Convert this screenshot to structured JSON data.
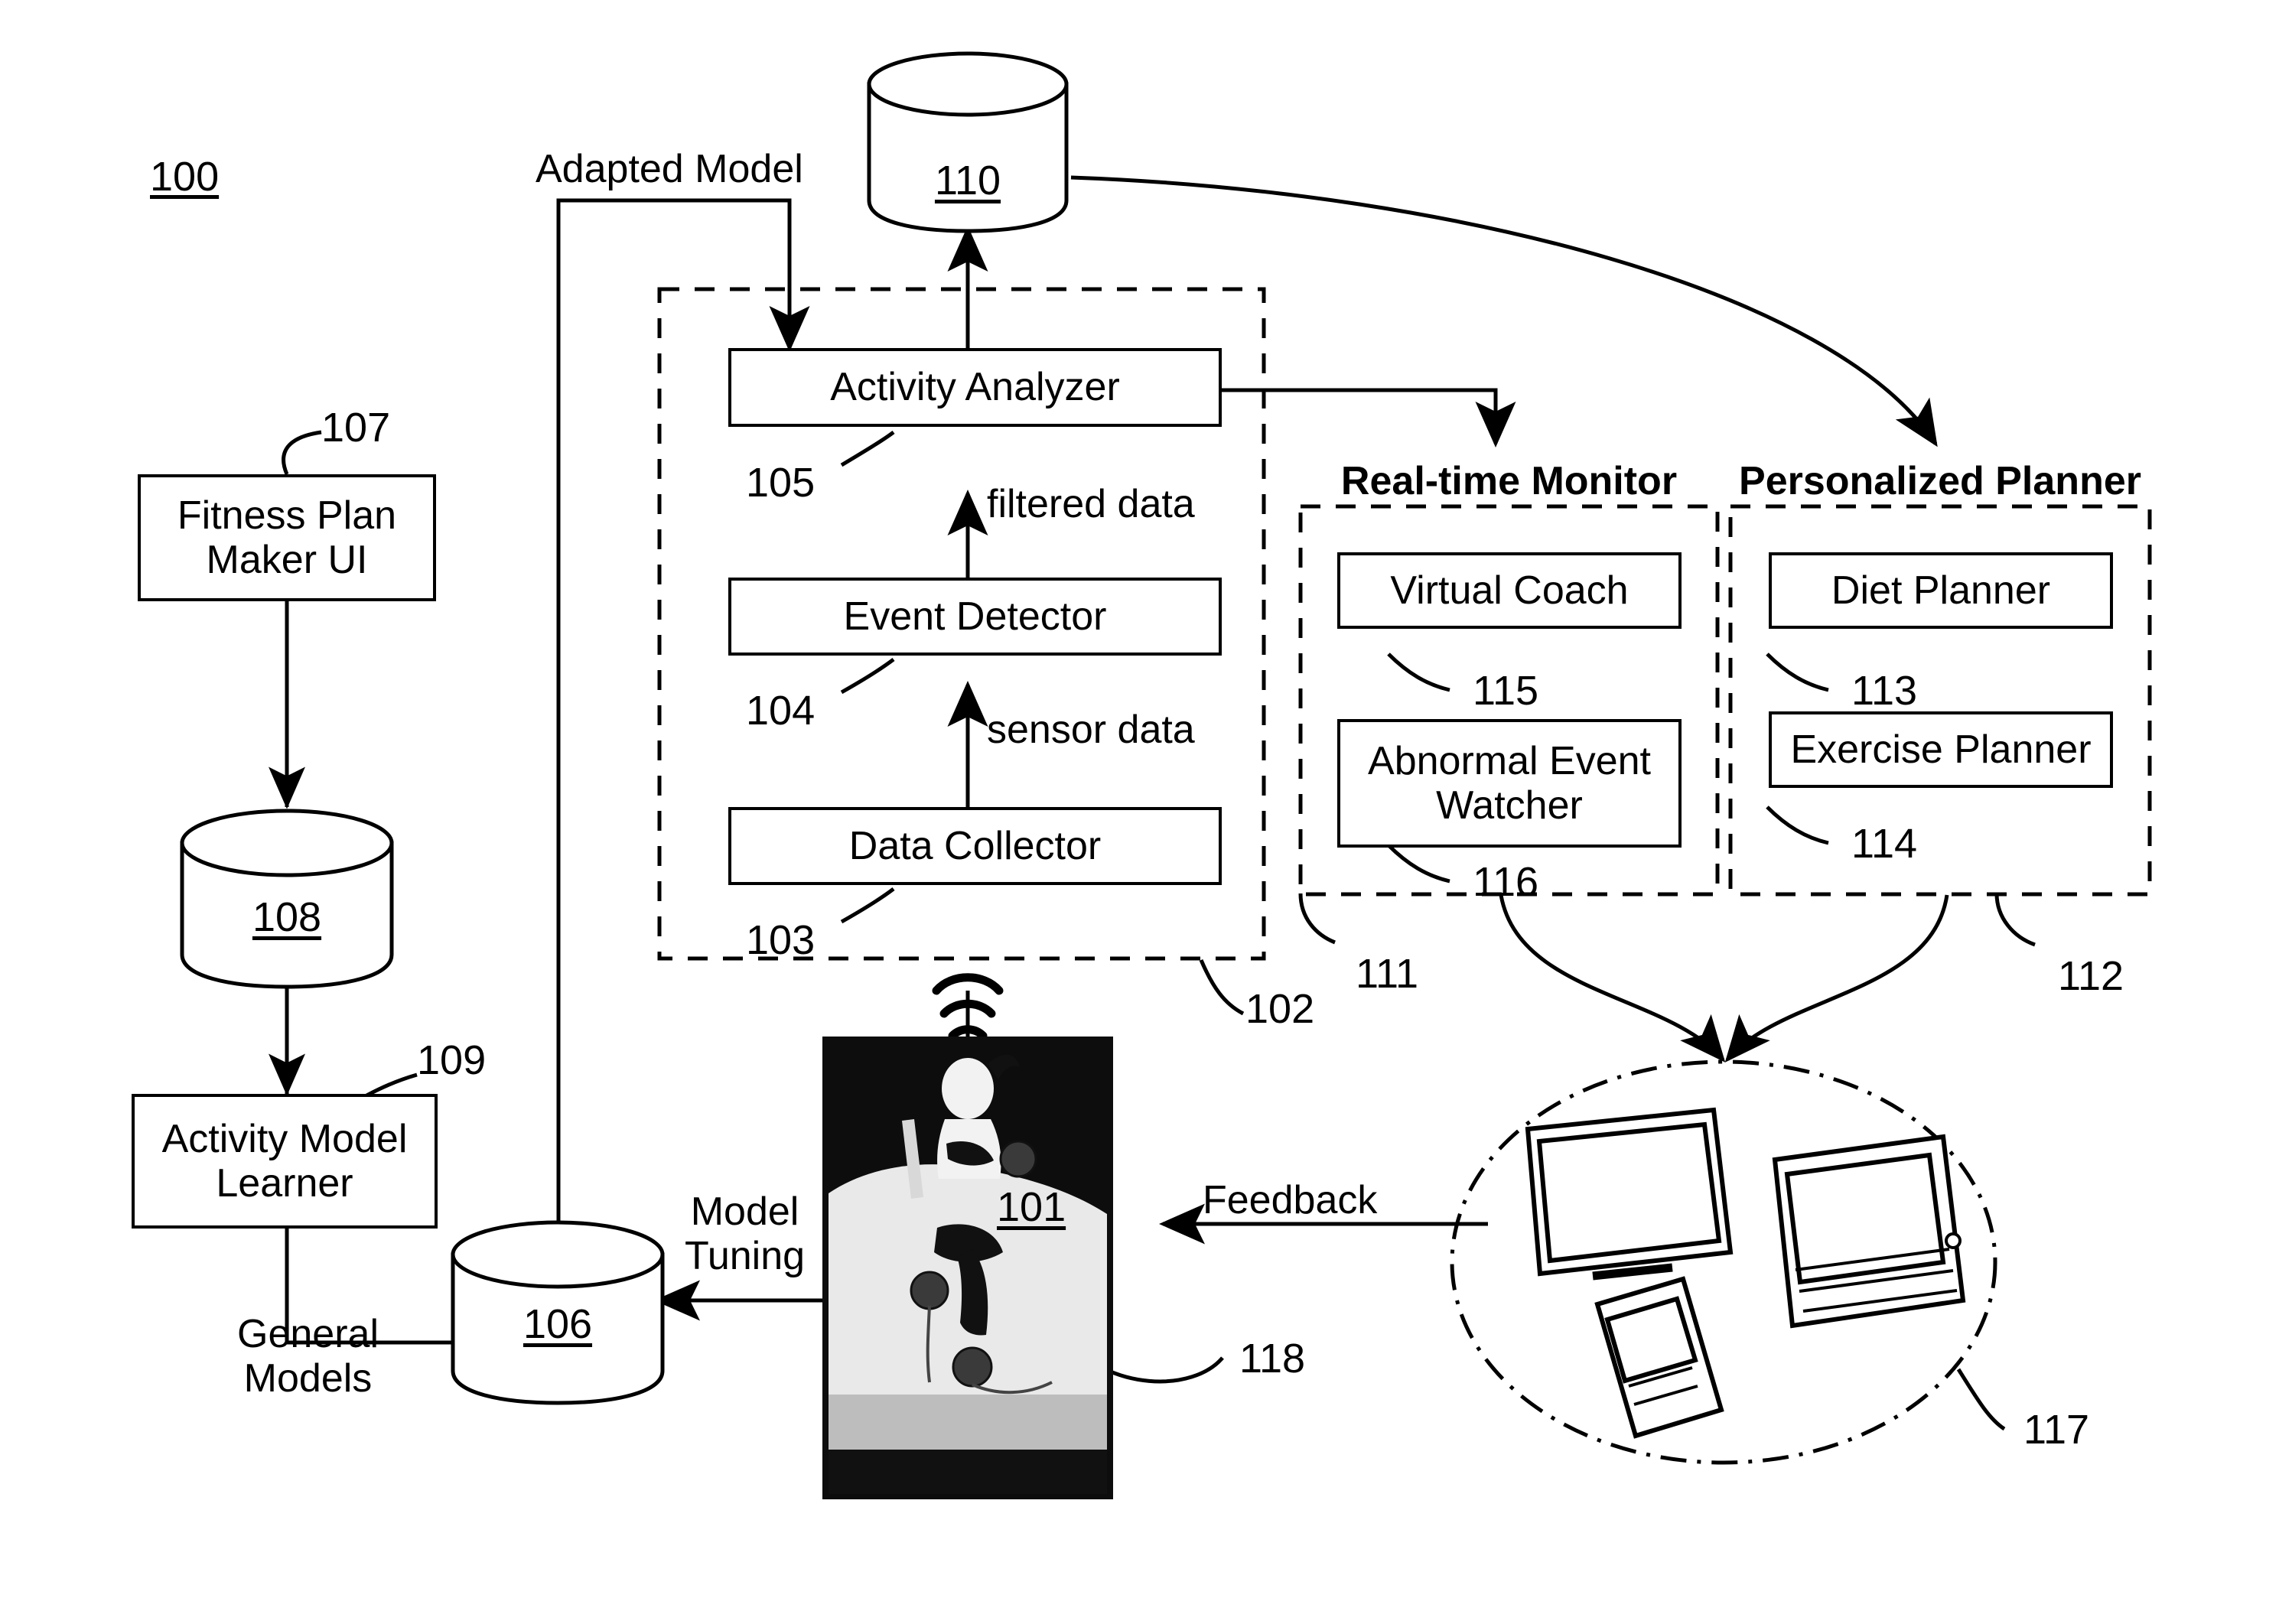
{
  "figure": {
    "ref_number": "100"
  },
  "nodes": {
    "fitness_plan_maker_ui": "Fitness Plan\nMaker UI",
    "activity_model_learner": "Activity Model\nLearner",
    "activity_analyzer": "Activity Analyzer",
    "event_detector": "Event Detector",
    "data_collector": "Data Collector",
    "virtual_coach": "Virtual Coach",
    "abnormal_event_watcher": "Abnormal Event\nWatcher",
    "diet_planner": "Diet Planner",
    "exercise_planner": "Exercise Planner"
  },
  "group_titles": {
    "real_time_monitor": "Real-time Monitor",
    "personalized_planner": "Personalized Planner"
  },
  "datastores": {
    "d110": "110",
    "d108": "108",
    "d106": "106"
  },
  "edge_labels": {
    "adapted_model": "Adapted Model",
    "filtered_data": "filtered data",
    "sensor_data": "sensor data",
    "general_models": "General\nModels",
    "model_tuning": "Model\nTuning",
    "feedback": "Feedback"
  },
  "ref_numbers": {
    "r100": "100",
    "r101": "101",
    "r102": "102",
    "r103": "103",
    "r104": "104",
    "r105": "105",
    "r107": "107",
    "r109": "109",
    "r111": "111",
    "r112": "112",
    "r113": "113",
    "r114": "114",
    "r115": "115",
    "r116": "116",
    "r117": "117",
    "r118": "118"
  },
  "icons": {
    "wireless": "wireless-signal-icon",
    "subject_photo": "exercising-person-photo",
    "device_tv": "tv-monitor-icon",
    "device_laptop": "laptop-keyboard-icon",
    "device_phone": "mobile-phone-icon"
  },
  "colors": {
    "ink": "#000000",
    "paper": "#ffffff"
  }
}
